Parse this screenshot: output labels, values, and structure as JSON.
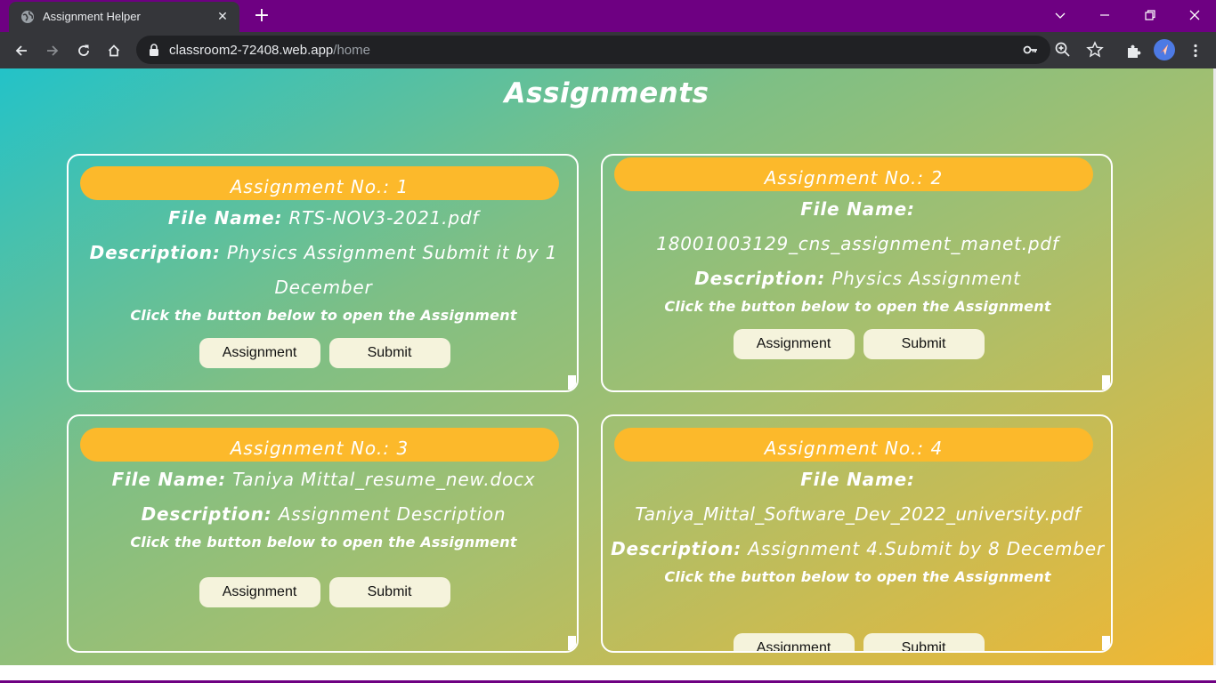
{
  "browser": {
    "tab_title": "Assignment Helper",
    "url_host": "classroom2-72408.web.app",
    "url_path": "/home"
  },
  "page": {
    "title": "Assignments",
    "hint": "Click the button below to open the Assignment",
    "file_label": "File Name:",
    "desc_label": "Description:",
    "assignment_button": "Assignment",
    "submit_button": "Submit"
  },
  "assignments": [
    {
      "header": "Assignment No.: 1",
      "file": "RTS-NOV3-2021.pdf",
      "description": "Physics Assignment Submit it by 1 December"
    },
    {
      "header": "Assignment No.: 2",
      "file": "18001003129_cns_assignment_manet.pdf",
      "description": "Physics Assignment"
    },
    {
      "header": "Assignment No.: 3",
      "file": "Taniya Mittal_resume_new.docx",
      "description": "Assignment Description"
    },
    {
      "header": "Assignment No.: 4",
      "file": "Taniya_Mittal_Software_Dev_2022_university.pdf",
      "description": "Assignment 4.Submit by 8 December"
    }
  ]
}
